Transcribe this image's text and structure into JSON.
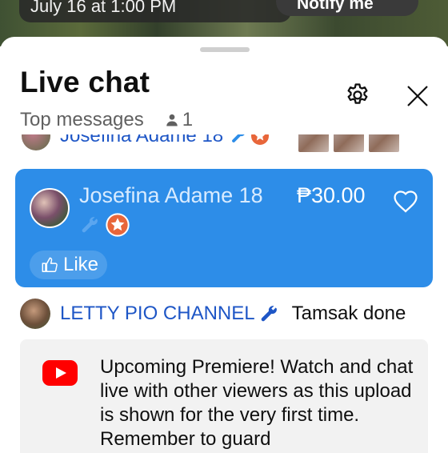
{
  "background": {
    "date_text": "July 16 at 1:00 PM",
    "notify_label": "Notify me"
  },
  "panel": {
    "title": "Live chat",
    "filter_label": "Top messages",
    "viewer_count": "1"
  },
  "partial_message": {
    "author": "Josefina Adame 18"
  },
  "superchat": {
    "author": "Josefina Adame 18",
    "amount": "₱30.00",
    "like_label": "Like",
    "background_color": "#2d8de8"
  },
  "message": {
    "author": "LETTY PIO CHANNEL",
    "text": "Tamsak done"
  },
  "notice": {
    "text": "Upcoming Premiere! Watch and chat live with other viewers as this upload is shown for the very first time. Remember to guard"
  },
  "icons": {
    "settings": "gear-icon",
    "close": "close-icon",
    "viewer": "person-icon",
    "moderator": "wrench-icon",
    "member": "star-badge-icon",
    "heart": "heart-icon",
    "like": "thumbs-up-icon",
    "youtube": "youtube-logo-icon"
  },
  "colors": {
    "link_name": "#1e56c6",
    "badge_orange": "#e8663a",
    "youtube_red": "#ff0000"
  }
}
